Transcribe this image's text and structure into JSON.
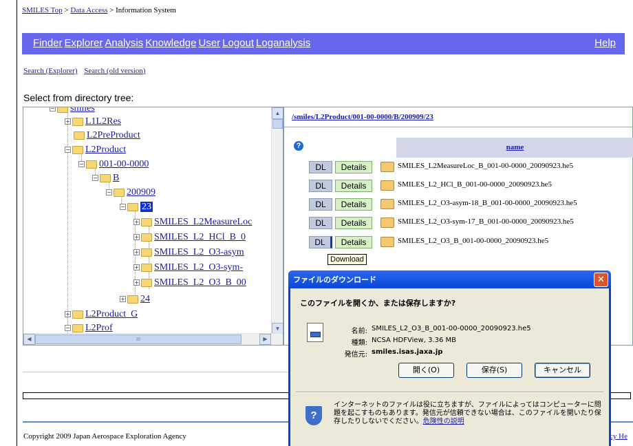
{
  "breadcrumb": {
    "top": "SMILES Top",
    "sep1": ">",
    "data_access": "Data Access",
    "sep2": ">",
    "current": "Information System"
  },
  "nav": {
    "items": [
      "Finder",
      "Explorer",
      "Analysis",
      "Knowledge",
      "User",
      "Logout",
      "Loganalysis"
    ],
    "help": "Help"
  },
  "sublinks": {
    "search_explorer": "Search (Explorer)",
    "search_old": "Search (old version)"
  },
  "tree": {
    "heading": "Select from directory tree:",
    "nodes": {
      "smiles": "smiles",
      "l1l2res": "L1L2Res",
      "l2preproduct": "L2PreProduct",
      "l2product": "L2Product",
      "n001": "001-00-0000",
      "b": "B",
      "d200909": "200909",
      "d23": "23",
      "f1": "SMILES_L2MeasureLoc",
      "f2": "SMILES_L2_HCl_B_0",
      "f3": "SMILES_L2_O3-asym",
      "f4": "SMILES_L2_O3-sym-",
      "f5": "SMILES_L2_O3_B_00",
      "d24": "24",
      "l2product_g": "L2Product_G",
      "l2prof": "L2Prof"
    }
  },
  "files": {
    "path": "/smiles/L2Product/001-00-0000/B/200909/23",
    "help_icon": "?",
    "name_header": "name",
    "dl_label": "DL",
    "details_label": "Details",
    "names": [
      "SMILES_L2MeasureLoc_B_001-00-0000_20090923.he5",
      "SMILES_L2_HCl_B_001-00-0000_20090923.he5",
      "SMILES_L2_O3-asym-18_B_001-00-0000_20090923.he5",
      "SMILES_L2_O3-sym-17_B_001-00-0000_20090923.he5",
      "SMILES_L2_O3_B_001-00-0000_20090923.he5"
    ],
    "tooltip": "Download"
  },
  "dialog": {
    "title": "ファイルのダウンロード",
    "close": "✕",
    "question": "このファイルを開くか、または保存しますか?",
    "name_label": "名前:",
    "name_value": "SMILES_L2_O3_B_001-00-0000_20090923.he5",
    "type_label": "種類:",
    "type_value": "NCSA HDFView, 3.36 MB",
    "from_label": "発信元:",
    "from_value": "smiles.isas.jaxa.jp",
    "open_button": "開く(O)",
    "save_button": "保存(S)",
    "cancel_button": "キャンセル",
    "warning_text": "インターネットのファイルは役に立ちますが、ファイルによってはコンピューターに問題を起こすものもあります。発信元が信頼できない場合は、このファイルを開いたり保存したりしないでください。",
    "warning_link": "危険性の説明"
  },
  "footer": {
    "copyright": "Copyright 2009 Japan Aerospace Exploration Agency",
    "links": "cy  He"
  }
}
